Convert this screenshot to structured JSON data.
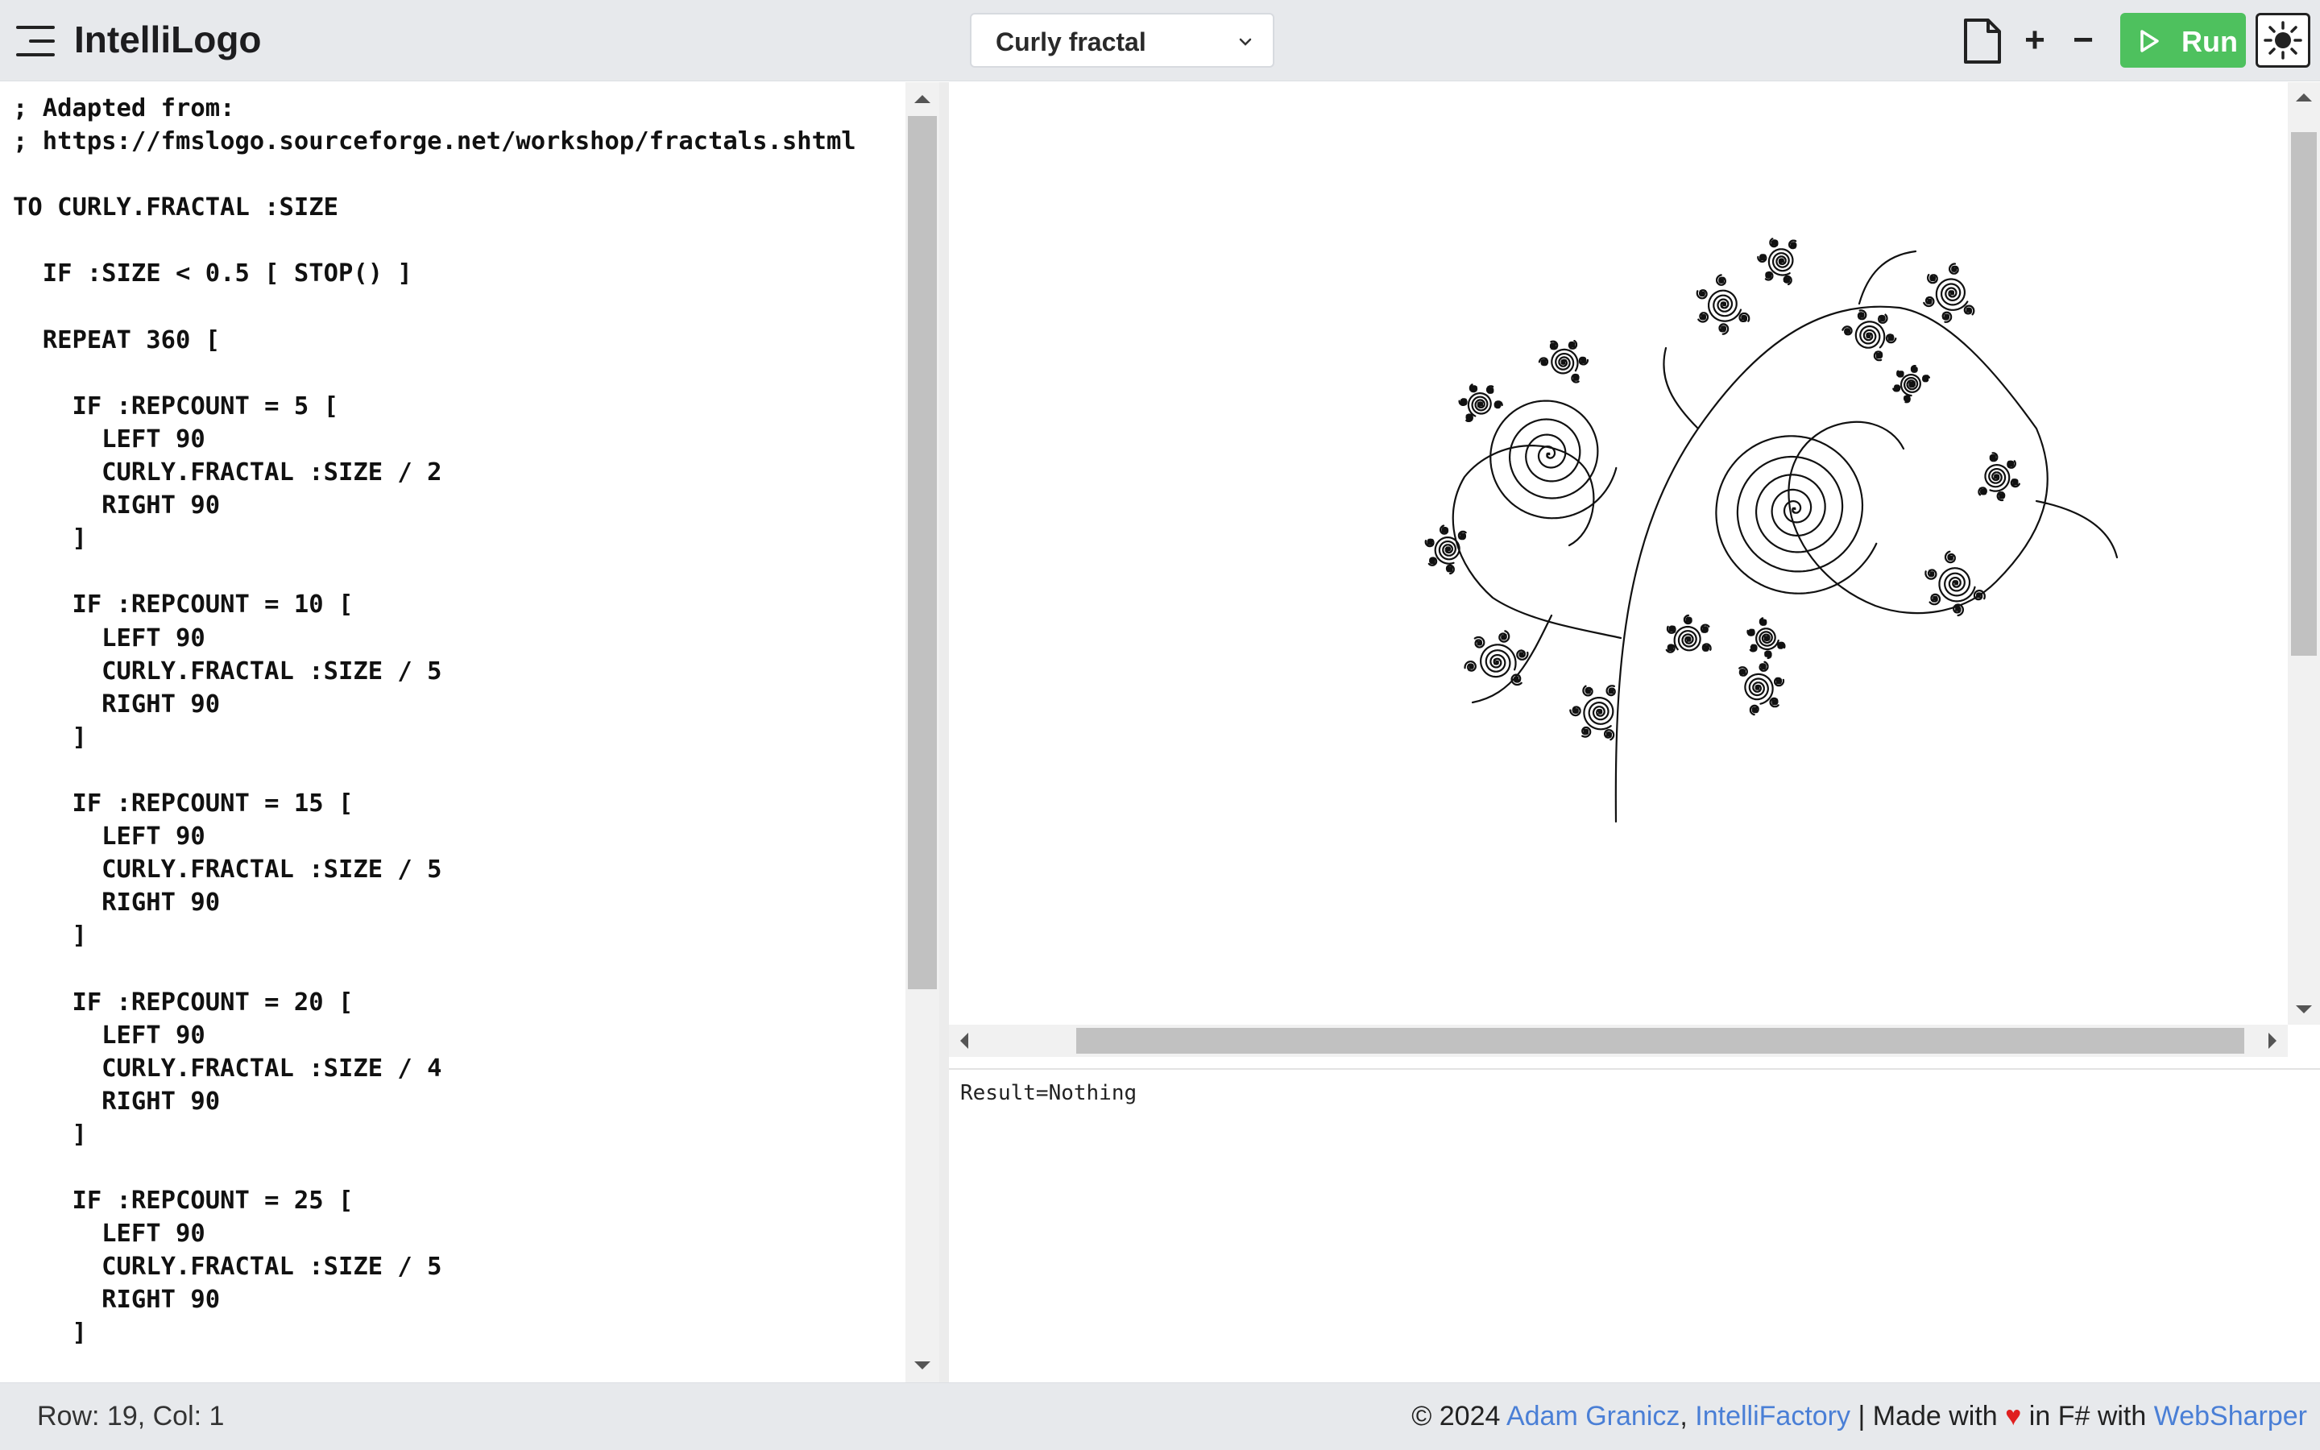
{
  "header": {
    "app_title": "IntelliLogo",
    "example_selected": "Curly fractal",
    "zoom_in_label": "+",
    "zoom_out_label": "−",
    "run_label": "Run"
  },
  "editor": {
    "lines": [
      "; Adapted from:",
      "; https://fmslogo.sourceforge.net/workshop/fractals.shtml",
      "",
      "TO CURLY.FRACTAL :SIZE",
      "",
      "  IF :SIZE < 0.5 [ STOP() ]",
      "",
      "  REPEAT 360 [",
      "",
      "    IF :REPCOUNT = 5 [",
      "      LEFT 90",
      "      CURLY.FRACTAL :SIZE / 2",
      "      RIGHT 90",
      "    ]",
      "",
      "    IF :REPCOUNT = 10 [",
      "      LEFT 90",
      "      CURLY.FRACTAL :SIZE / 5",
      "      RIGHT 90",
      "    ]",
      "",
      "    IF :REPCOUNT = 15 [",
      "      LEFT 90",
      "      CURLY.FRACTAL :SIZE / 5",
      "      RIGHT 90",
      "    ]",
      "",
      "    IF :REPCOUNT = 20 [",
      "      LEFT 90",
      "      CURLY.FRACTAL :SIZE / 4",
      "      RIGHT 90",
      "    ]",
      "",
      "    IF :REPCOUNT = 25 [",
      "      LEFT 90",
      "      CURLY.FRACTAL :SIZE / 5",
      "      RIGHT 90",
      "    ]"
    ]
  },
  "output": {
    "result": "Result=Nothing"
  },
  "status": {
    "position": "Row: 19, Col: 1"
  },
  "footer": {
    "copyright": "© 2024 ",
    "author": "Adam Granicz",
    "comma": ", ",
    "company": "IntelliFactory",
    "made_with": " | Made with ",
    "heart": "♥",
    "in_fsharp": " in F# with ",
    "framework": "WebSharper"
  },
  "colors": {
    "run_button": "#4ec15e",
    "link": "#4a7fd6",
    "heart": "#e02020",
    "header_bg": "#e7e9ec"
  },
  "icons": {
    "menu": "hamburger-menu-icon",
    "new_file": "new-file-icon",
    "run": "play-icon",
    "theme": "sun-icon",
    "dropdown": "chevron-down-icon"
  }
}
